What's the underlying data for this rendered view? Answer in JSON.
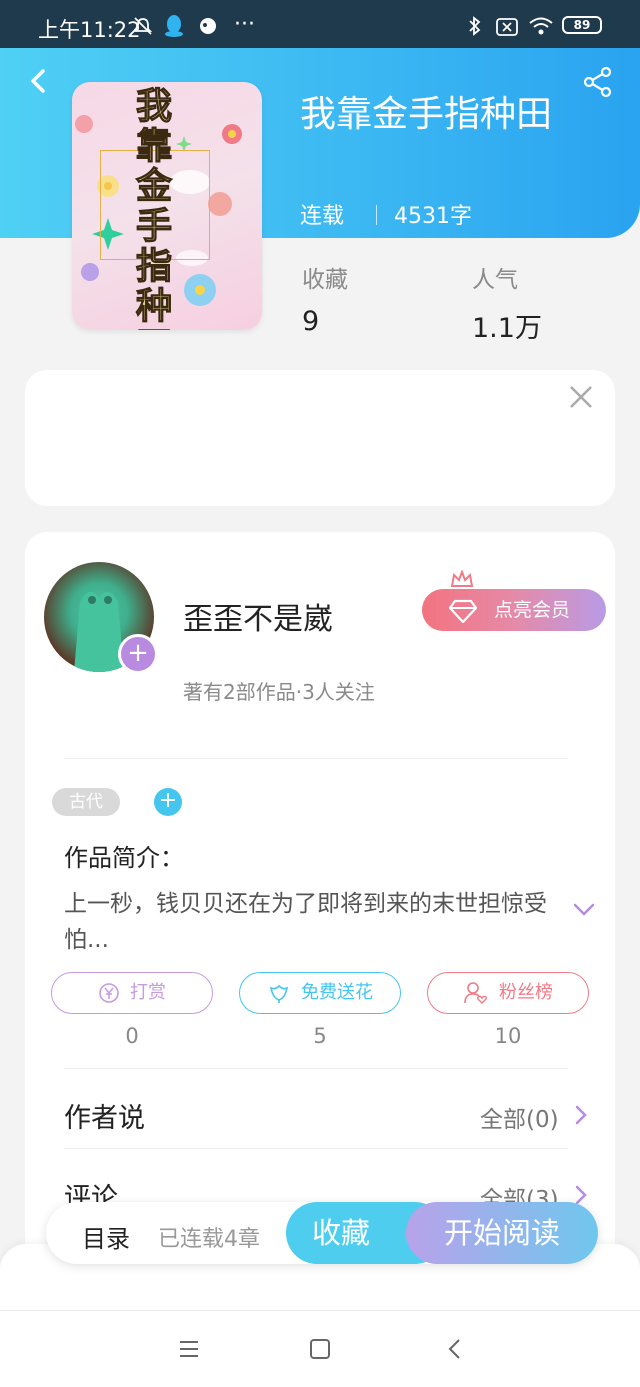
{
  "status_bar": {
    "time": "上午11:22",
    "icons": [
      "mute-icon",
      "qq-icon",
      "chat-icon",
      "more-dots-icon",
      "bluetooth-icon",
      "sim-icon",
      "wifi-icon"
    ],
    "more": "···",
    "battery": "89"
  },
  "header": {
    "back_icon": "back-arrow-icon",
    "share_icon": "share-icon",
    "cover_title": "我靠金手指种田",
    "book_title": "我靠金手指种田",
    "status": "连载",
    "word_count": "4531字",
    "stats": [
      {
        "label": "收藏",
        "value": "9"
      },
      {
        "label": "人气",
        "value": "1.1万"
      }
    ]
  },
  "ad": {
    "close_icon": "close-icon"
  },
  "author": {
    "name": "歪歪不是崴",
    "meta": "著有2部作品·3人关注",
    "follow_plus": "+",
    "vip_label": "点亮会员"
  },
  "tags": {
    "items": [
      "古代"
    ],
    "add": "+"
  },
  "synopsis": {
    "title": "作品简介：",
    "text": "上一秒，钱贝贝还在为了即将到来的末世担惊受怕..."
  },
  "actions": [
    {
      "label": "打赏",
      "count": "0",
      "color": "#c69be0",
      "icon": "yen-coin-icon"
    },
    {
      "label": "免费送花",
      "count": "5",
      "color": "#45c6ef",
      "icon": "flower-icon"
    },
    {
      "label": "粉丝榜",
      "count": "10",
      "color": "#f07a86",
      "icon": "fan-rank-icon"
    }
  ],
  "author_says": {
    "title": "作者说",
    "right": "全部(0)"
  },
  "comments": {
    "title": "评论",
    "right": "全部(3)"
  },
  "bottom_bar": {
    "toc": "目录",
    "chapters": "已连载4章",
    "favorite": "收藏",
    "start_reading": "开始阅读"
  },
  "nav": {
    "icons": [
      "menu-icon",
      "home-square-icon",
      "back-triangle-icon"
    ]
  },
  "colors": {
    "accent_blue": "#3ab6f2",
    "accent_purple": "#b98be0",
    "vip_pink": "#f3737f"
  }
}
